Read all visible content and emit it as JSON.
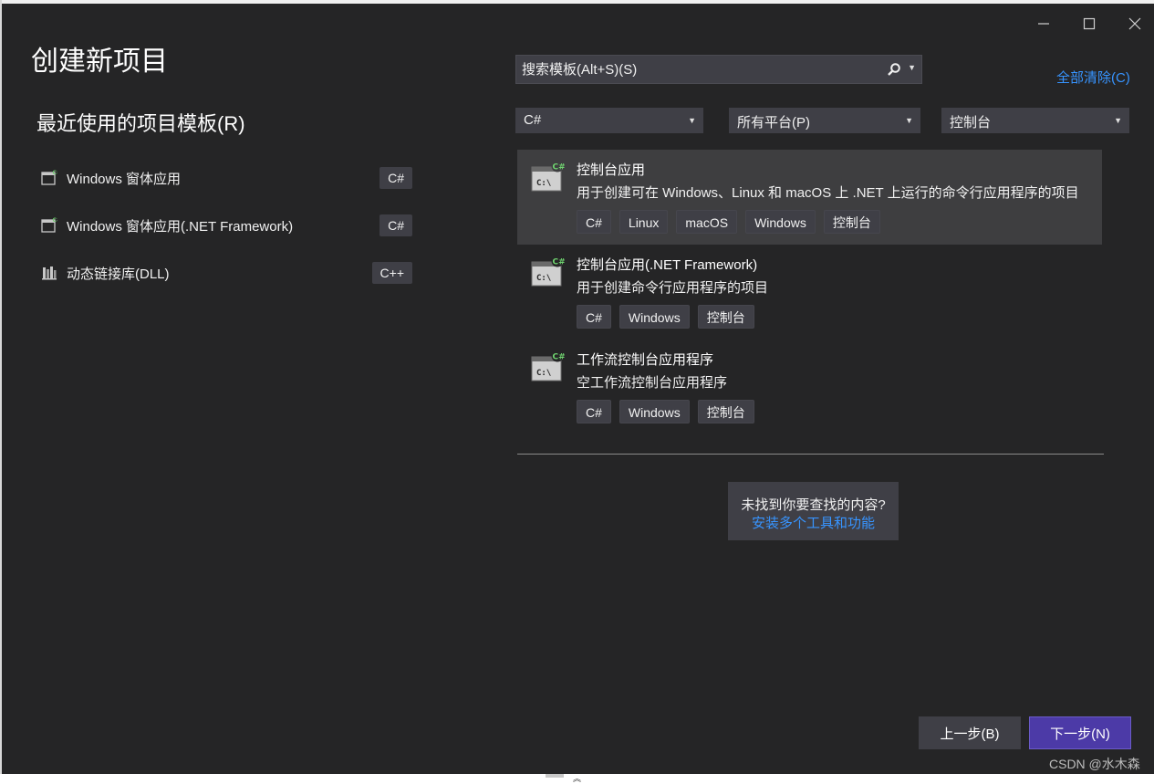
{
  "window": {
    "title": "创建新项目",
    "colors": {
      "background": "#252526",
      "accent": "#4c3aa7",
      "link": "#3794ff"
    }
  },
  "recent": {
    "title": "最近使用的项目模板(R)",
    "items": [
      {
        "label": "Windows 窗体应用",
        "badge": "C#",
        "icon": "windows-forms-icon"
      },
      {
        "label": "Windows 窗体应用(.NET Framework)",
        "badge": "C#",
        "icon": "windows-forms-icon"
      },
      {
        "label": "动态链接库(DLL)",
        "badge": "C++",
        "icon": "dll-library-icon"
      }
    ]
  },
  "search": {
    "placeholder": "搜索模板(Alt+S)(S)",
    "icon": "search-icon"
  },
  "clear_all": "全部清除(C)",
  "filters": {
    "language": "C#",
    "platform": "所有平台(P)",
    "project_type": "控制台"
  },
  "templates": [
    {
      "name": "控制台应用",
      "description": "用于创建可在 Windows、Linux 和 macOS 上 .NET 上运行的命令行应用程序的项目",
      "tags": [
        "C#",
        "Linux",
        "macOS",
        "Windows",
        "控制台"
      ],
      "selected": true,
      "icon": "console-app-icon"
    },
    {
      "name": "控制台应用(.NET Framework)",
      "description": "用于创建命令行应用程序的项目",
      "tags": [
        "C#",
        "Windows",
        "控制台"
      ],
      "selected": false,
      "icon": "console-app-icon"
    },
    {
      "name": "工作流控制台应用程序",
      "description": "空工作流控制台应用程序",
      "tags": [
        "C#",
        "Windows",
        "控制台"
      ],
      "selected": false,
      "icon": "console-app-icon"
    }
  ],
  "not_found": {
    "question": "未找到你要查找的内容?",
    "link": "安装多个工具和功能"
  },
  "buttons": {
    "back": "上一步(B)",
    "next": "下一步(N)"
  },
  "watermark": "CSDN @水木森"
}
